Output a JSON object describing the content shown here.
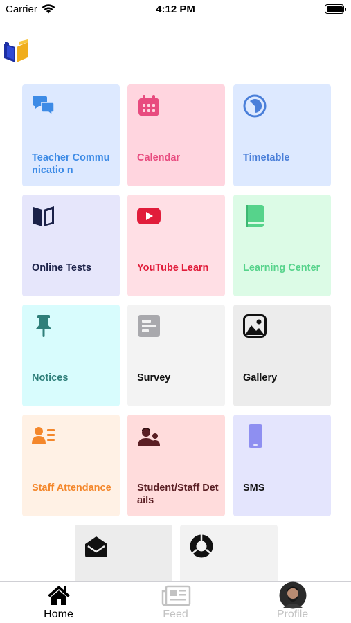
{
  "status_bar": {
    "carrier": "Carrier",
    "time": "4:12 PM"
  },
  "tiles": [
    {
      "label": "Teacher Communicatio n",
      "icon": "chat-bubbles-icon",
      "bg": "#dde9ff",
      "color": "#3d8be6"
    },
    {
      "label": "Calendar",
      "icon": "calendar-icon",
      "bg": "#ffd5df",
      "color": "#e84b7f"
    },
    {
      "label": "Timetable",
      "icon": "clock-icon",
      "bg": "#dde9ff",
      "color": "#4a7fd9"
    },
    {
      "label": "Online Tests",
      "icon": "book-icon",
      "bg": "#e6e6fb",
      "color": "#1b2148"
    },
    {
      "label": "YouTube Learn",
      "icon": "youtube-icon",
      "bg": "#ffdfe5",
      "color": "#e11d3b"
    },
    {
      "label": "Learning Center",
      "icon": "green-book-icon",
      "bg": "#dcfbe6",
      "color": "#56d38b"
    },
    {
      "label": "Notices",
      "icon": "pin-icon",
      "bg": "#d8fcfd",
      "color": "#2f7f7a"
    },
    {
      "label": "Survey",
      "icon": "survey-doc-icon",
      "bg": "#f3f3f3",
      "color": "#111111"
    },
    {
      "label": "Gallery",
      "icon": "image-icon",
      "bg": "#ececec",
      "color": "#111111"
    },
    {
      "label": "Staff Attendance",
      "icon": "id-card-icon",
      "bg": "#fff1e5",
      "color": "#f4872b"
    },
    {
      "label": "Student/Staff Details",
      "icon": "people-icon",
      "bg": "#ffdcdc",
      "color": "#5a1f24"
    },
    {
      "label": "SMS",
      "icon": "phone-icon",
      "bg": "#e4e5fd",
      "color": "#141414"
    },
    {
      "label": "",
      "icon": "envelope-open-icon",
      "bg": "#ececec",
      "color": "#111111"
    },
    {
      "label": "",
      "icon": "donut-chart-icon",
      "bg": "#f2f2f2",
      "color": "#111111"
    }
  ],
  "tabs": [
    {
      "label": "Home",
      "icon": "home-icon",
      "active": true
    },
    {
      "label": "Feed",
      "icon": "newspaper-icon",
      "active": false
    },
    {
      "label": "Profile",
      "icon": "avatar-icon",
      "active": false
    }
  ],
  "colors": {
    "tab_active": "#000000",
    "tab_inactive": "#c2c2c2"
  }
}
